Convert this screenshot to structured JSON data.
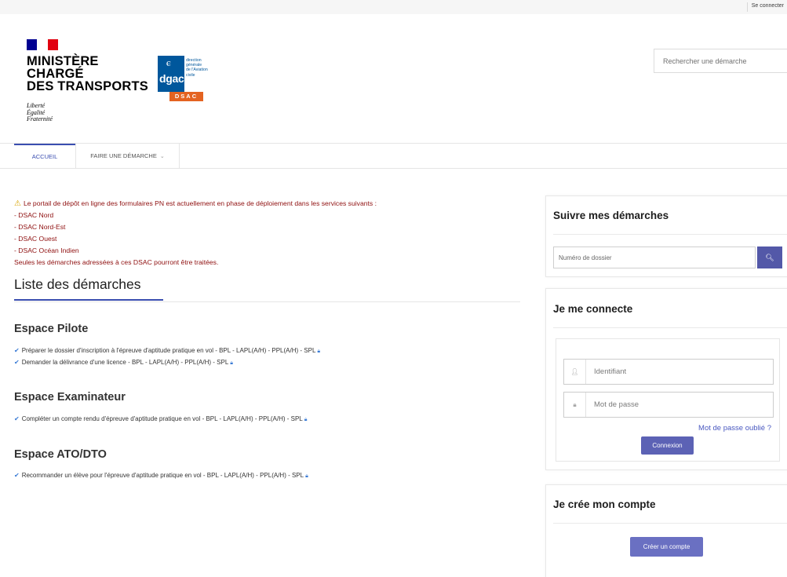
{
  "topbar": {
    "login_link": "Se connecter"
  },
  "header": {
    "ministry_line1": "MINISTÈRE",
    "ministry_line2": "CHARGÉ",
    "ministry_line3": "DES TRANSPORTS",
    "motto_1": "Liberté",
    "motto_2": "Égalité",
    "motto_3": "Fraternité",
    "dgac_name": "dgac",
    "dgac_sub_1": "direction",
    "dgac_sub_2": "générale",
    "dgac_sub_3": "de l'Aviation",
    "dgac_sub_4": "civile",
    "dsac": "DSAC",
    "search_placeholder": "Rechercher une démarche"
  },
  "nav": {
    "home": "ACCUEIL",
    "procedure": "FAIRE UNE DÉMARCHE",
    "procedure_chevron": "⌄"
  },
  "notice": {
    "icon": "warning-icon",
    "line1": "Le portail de dépôt en ligne des formulaires PN est actuellement en phase de déploiement dans les services suivants :",
    "items": [
      "- DSAC Nord",
      "- DSAC Nord-Est",
      "- DSAC Ouest",
      "- DSAC Océan Indien"
    ],
    "footer": "Seules les démarches adressées à ces DSAC pourront être traitées."
  },
  "main": {
    "list_title": "Liste des démarches",
    "spaces": [
      {
        "title": "Espace Pilote",
        "procedures": [
          "Préparer le dossier d'inscription à l'épreuve d'aptitude pratique en vol - BPL - LAPL(A/H) - PPL(A/H) - SPL",
          "Demander la délivrance d'une licence - BPL - LAPL(A/H) - PPL(A/H) - SPL"
        ]
      },
      {
        "title": "Espace Examinateur",
        "procedures": [
          "Compléter un compte rendu d'épreuve d'aptitude pratique en vol - BPL - LAPL(A/H) - PPL(A/H) - SPL"
        ]
      },
      {
        "title": "Espace ATO/DTO",
        "procedures": [
          "Recommander un élève pour l'épreuve d'aptitude pratique en vol - BPL - LAPL(A/H) - PPL(A/H) - SPL"
        ]
      }
    ]
  },
  "sidebar": {
    "track": {
      "title": "Suivre mes démarches",
      "placeholder": "Numéro de dossier",
      "button_icon": "search-icon"
    },
    "login": {
      "title": "Je me connecte",
      "username_placeholder": "Identifiant",
      "password_placeholder": "Mot de passe",
      "forgot": "Mot de passe oublié ?",
      "submit": "Connexion"
    },
    "signup": {
      "title": "Je crée mon compte",
      "button": "Créer un compte"
    }
  },
  "colors": {
    "accent": "#3a4eb0",
    "button": "#5c62b5",
    "notice": "#8f1010",
    "dgac_blue": "#00579c",
    "dsac_orange": "#e46321"
  }
}
